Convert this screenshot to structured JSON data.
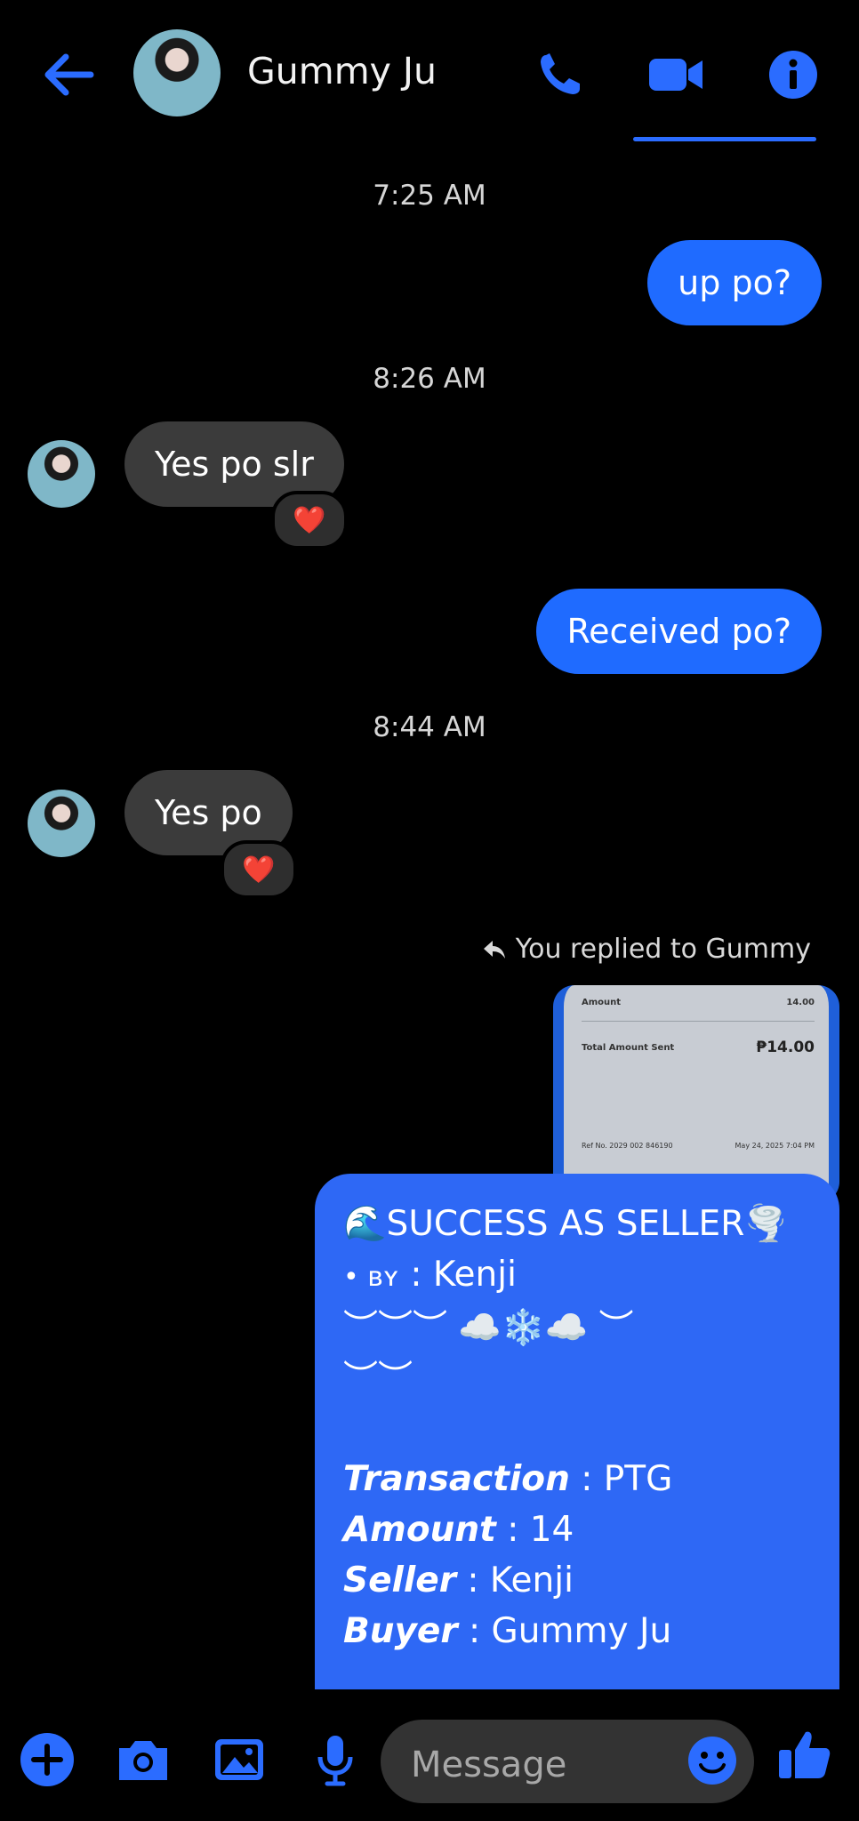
{
  "header": {
    "contact_name": "Gummy Ju",
    "icons": [
      "back-arrow-icon",
      "phone-icon",
      "video-icon",
      "info-icon"
    ],
    "accent": "#2b6cff"
  },
  "messages": {
    "ts1": "7:25 AM",
    "me1": "up po?",
    "ts2": "8:26 AM",
    "them1": "Yes po slr",
    "reaction": "❤️",
    "me2": "Received po?",
    "ts3": "8:44 AM",
    "them2": "Yes po",
    "reply_note": "You replied to Gummy"
  },
  "receipt": {
    "amount_label": "Amount",
    "amount_value": "14.00",
    "total_label": "Total Amount Sent",
    "total_value": "₱14.00",
    "ref_label": "Ref No. 2029 002 846190",
    "date": "May 24, 2025 7:04 PM"
  },
  "big_message": {
    "title": "🌊SUCCESS AS SELLER🌪️",
    "by_prefix": "• ʙʏ",
    "by_value": ": Kenji",
    "deco1": "︶︶︶ ☁️❄️☁️ ︶",
    "deco2": "︶︶",
    "lines": [
      {
        "label": "Transaction",
        "value": " : PTG"
      },
      {
        "label": "Amount",
        "value": " : 14"
      },
      {
        "label": "Seller",
        "value": " : Kenji"
      },
      {
        "label": "Buyer",
        "value": " : Gummy Ju"
      }
    ]
  },
  "composer": {
    "placeholder": "Message",
    "icons": [
      "plus-icon",
      "camera-icon",
      "gallery-icon",
      "mic-icon",
      "emoji-icon",
      "thumbs-up-icon"
    ]
  }
}
